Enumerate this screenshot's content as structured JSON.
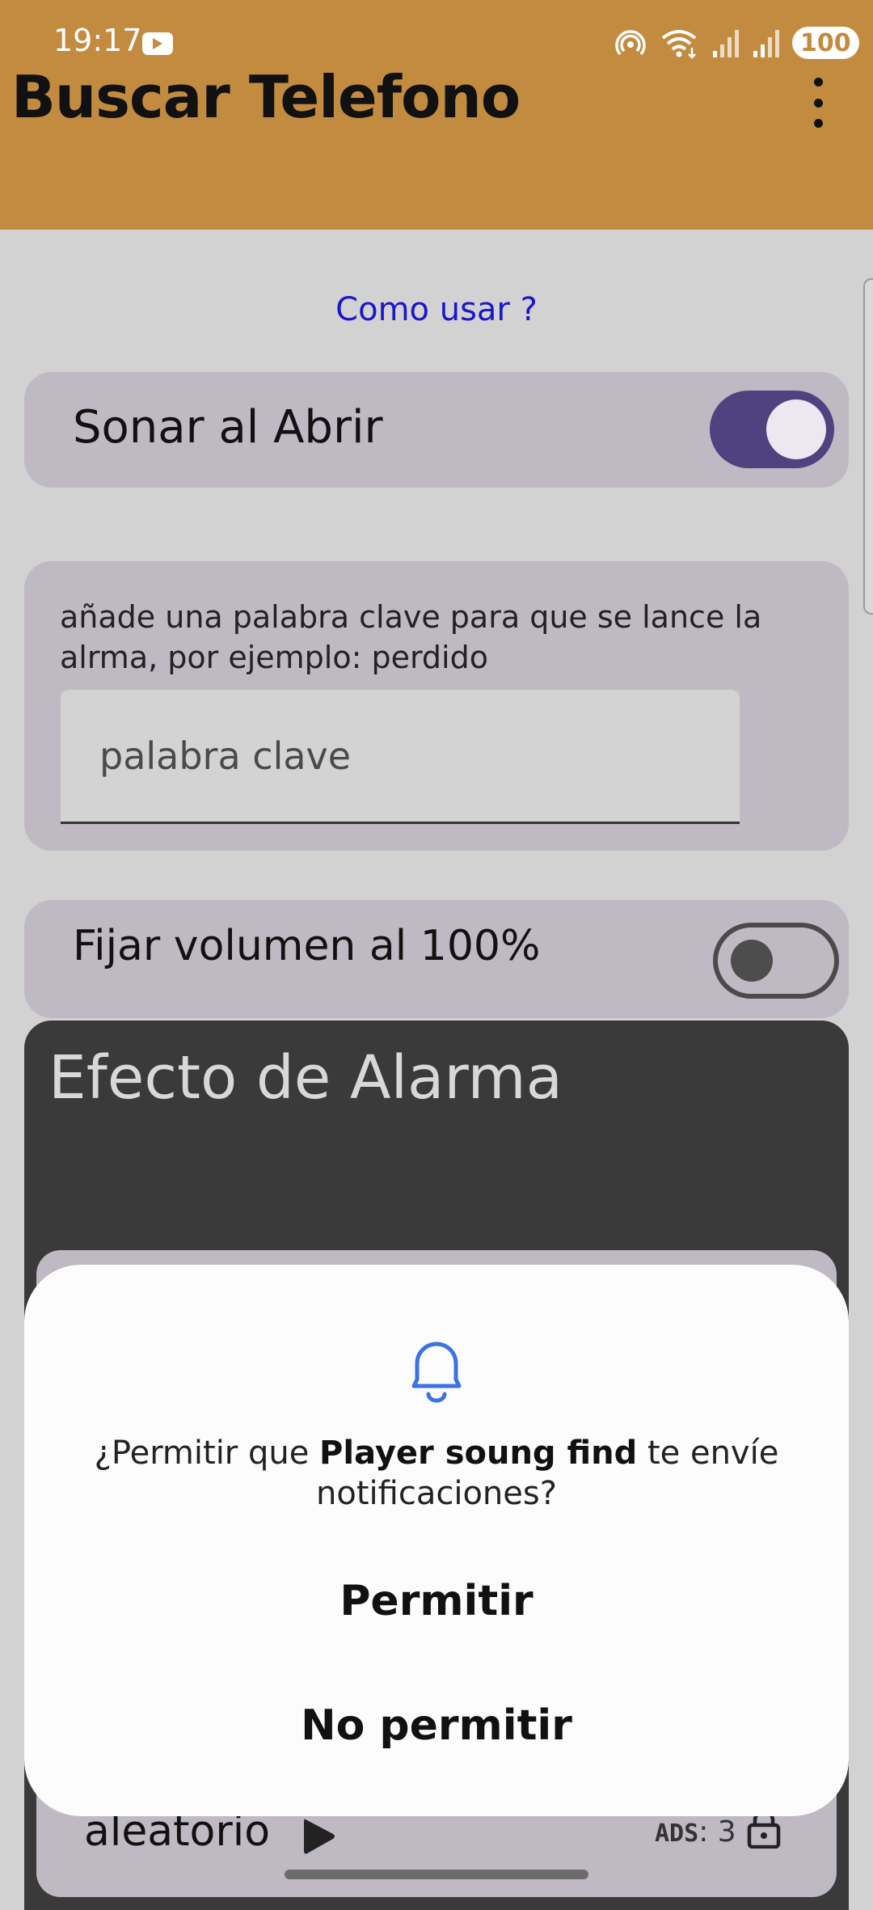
{
  "status_bar": {
    "time": "19:17",
    "battery": "100",
    "icons": [
      "youtube-icon",
      "hotspot-icon",
      "wifi-icon",
      "signal-icon",
      "signal-icon"
    ]
  },
  "app_bar": {
    "title": "Buscar Telefono",
    "menu_icon": "more-vertical-icon"
  },
  "help_link": "Como usar ?",
  "sonar_card": {
    "label": "Sonar al Abrir",
    "enabled": true
  },
  "keyword_card": {
    "description": "añade una palabra clave para que se lance la alrma, por ejemplo: perdido",
    "input_value": "",
    "placeholder": "palabra clave"
  },
  "volume_card": {
    "label": "Fijar volumen al 100%",
    "enabled": false
  },
  "alarm_section": {
    "title": "Efecto de Alarma",
    "random_label": "aleatorio",
    "ads_label": "ADS",
    "ads_value": ": 3"
  },
  "dialog": {
    "icon": "bell-icon",
    "text_before": "¿Permitir que ",
    "app_name": "Player soung find",
    "text_after": " te envíe notificaciones?",
    "allow_label": "Permitir",
    "deny_label": "No permitir"
  },
  "colors": {
    "app_bar": "#c28b3f",
    "background": "#d2d2d2",
    "card": "#bfb9c3",
    "toggle_on": "#4e4280",
    "link": "#1a17c7",
    "bell": "#3b73e0"
  }
}
